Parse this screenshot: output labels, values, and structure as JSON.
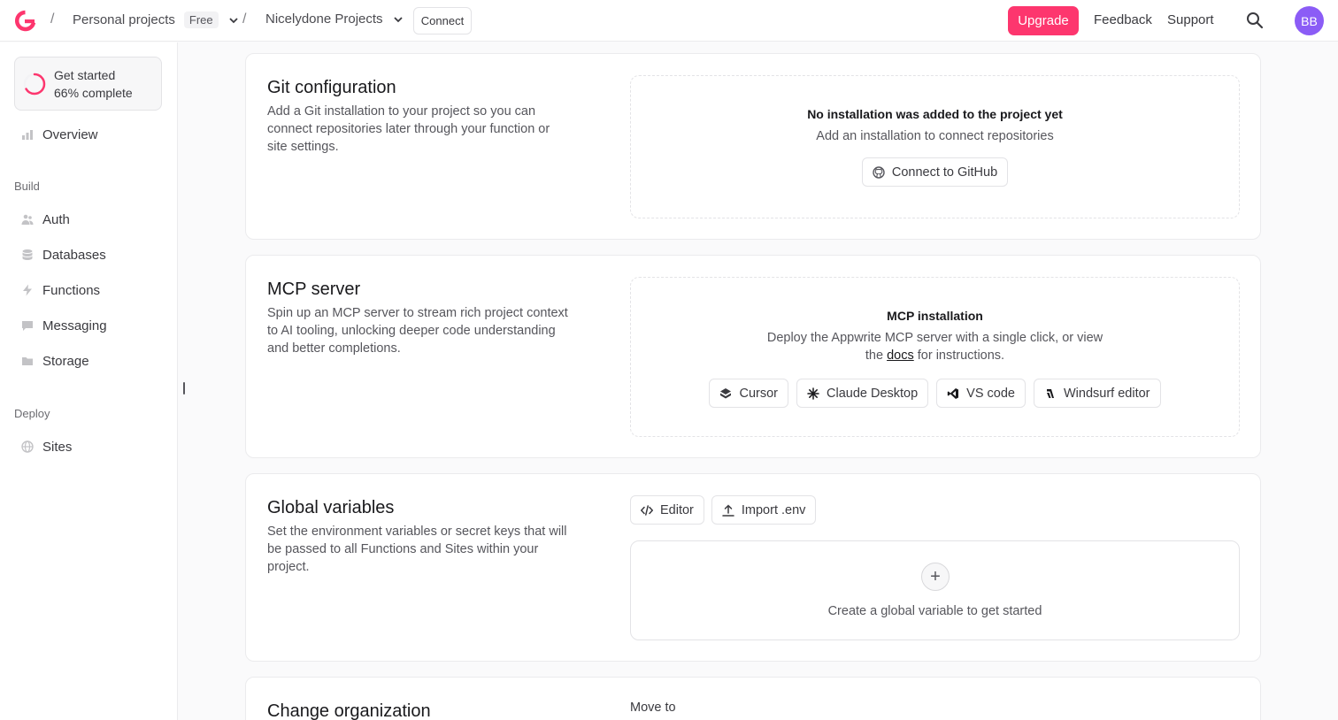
{
  "topbar": {
    "org_name": "Personal projects",
    "org_badge": "Free",
    "project_name": "Nicelydone Projects",
    "connect_label": "Connect",
    "upgrade_label": "Upgrade",
    "feedback_label": "Feedback",
    "support_label": "Support",
    "avatar_initials": "BB",
    "separator": "/"
  },
  "sidebar": {
    "get_started": {
      "title": "Get started",
      "progress_text": "66% complete",
      "progress_fraction": 0.66
    },
    "overview_label": "Overview",
    "build_section": "Build",
    "build_items": [
      {
        "label": "Auth",
        "icon": "users-icon"
      },
      {
        "label": "Databases",
        "icon": "database-icon"
      },
      {
        "label": "Functions",
        "icon": "lightning-icon"
      },
      {
        "label": "Messaging",
        "icon": "chat-icon"
      },
      {
        "label": "Storage",
        "icon": "folder-icon"
      }
    ],
    "deploy_section": "Deploy",
    "deploy_items": [
      {
        "label": "Sites",
        "icon": "globe-icon"
      }
    ]
  },
  "git": {
    "title": "Git configuration",
    "desc": "Add a Git installation to your project so you can connect repositories later through your function or site settings.",
    "empty_title": "No installation was added to the project yet",
    "empty_sub": "Add an installation to connect repositories",
    "connect_label": "Connect to GitHub"
  },
  "mcp": {
    "title": "MCP server",
    "desc": "Spin up an MCP server to stream rich project context to AI tooling, unlocking deeper code understanding and better completions.",
    "install_title": "MCP installation",
    "install_sub_1": "Deploy the Appwrite MCP server with a single click, or view",
    "install_sub_2a": "the",
    "install_docs": "docs",
    "install_sub_2b": "for instructions.",
    "buttons": [
      "Cursor",
      "Claude Desktop",
      "VS code",
      "Windsurf editor"
    ]
  },
  "globals": {
    "title": "Global variables",
    "desc": "Set the environment variables or secret keys that will be passed to all Functions and Sites within your project.",
    "editor_label": "Editor",
    "import_label": "Import .env",
    "empty_label": "Create a global variable to get started"
  },
  "org": {
    "title": "Change organization",
    "move_label": "Move to"
  },
  "colors": {
    "accent": "#fd366e",
    "avatar": "#8b5cf6"
  }
}
